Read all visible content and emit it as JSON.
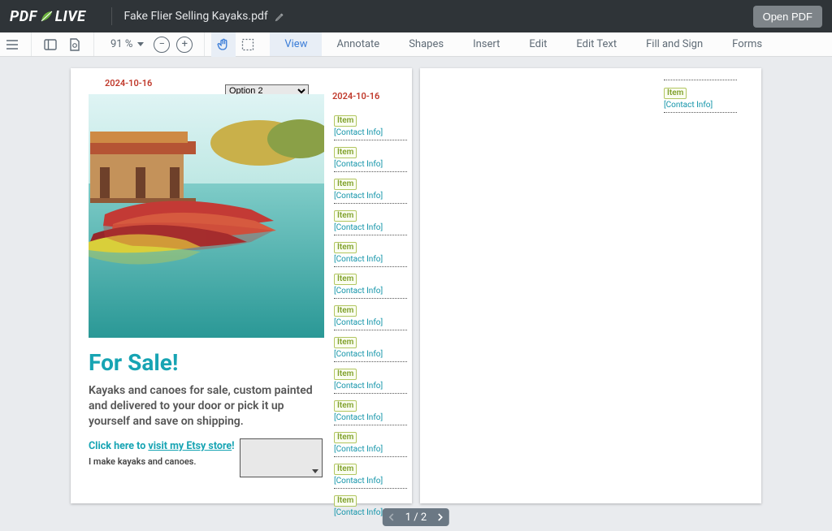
{
  "header": {
    "logo_pdf": "PDF",
    "logo_live": "LIVE",
    "file_name": "Fake Flier Selling Kayaks.pdf",
    "open_pdf": "Open PDF"
  },
  "toolbar": {
    "zoom_value": "91 %",
    "tabs": [
      "View",
      "Annotate",
      "Shapes",
      "Insert",
      "Edit",
      "Edit Text",
      "Fill and Sign",
      "Forms"
    ],
    "active_tab": "View"
  },
  "page1": {
    "date_left": "2024-10-16",
    "date_right": "2024-10-16",
    "select_option": "Option 2",
    "for_sale": "For Sale!",
    "description": "Kayaks and canoes for sale, custom painted and delivered to your door or pick it up yourself and save on shipping.",
    "etsy_prefix": "Click here to ",
    "etsy_link": "visit my Etsy store",
    "etsy_suffix": "!",
    "tagline": "I make kayaks and canoes.",
    "tab_item": "Item",
    "tab_contact": "[Contact Info]",
    "tab_count": 13
  },
  "page2": {
    "tab_item": "Item",
    "tab_contact": "[Contact Info]"
  },
  "pagination": {
    "text": "1 / 2"
  }
}
